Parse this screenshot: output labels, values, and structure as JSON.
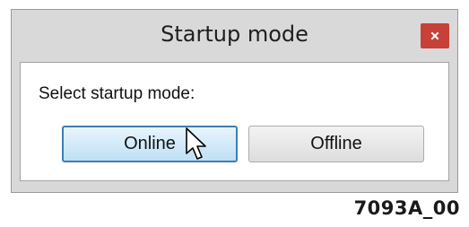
{
  "window": {
    "title": "Startup mode",
    "close_icon": "close-icon"
  },
  "dialog": {
    "prompt": "Select startup mode:",
    "buttons": [
      {
        "label": "Online",
        "state": "hovered"
      },
      {
        "label": "Offline",
        "state": "normal"
      }
    ]
  },
  "caption": "7093A_00",
  "colors": {
    "window_frame": "#d9d9d9",
    "close_button": "#c7403a",
    "hover_border": "#3c7fb1",
    "hover_fill": "#bfe0f5"
  }
}
